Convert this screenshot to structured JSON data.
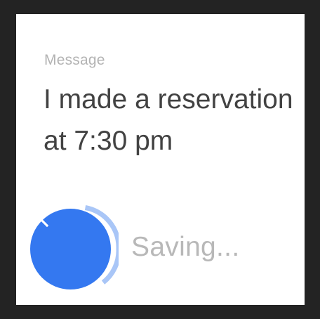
{
  "card": {
    "label": "Message",
    "message": "I made a reservation at 7:30 pm"
  },
  "action": {
    "icon": "close-icon",
    "status": "Saving...",
    "progress": 0.3,
    "colors": {
      "button": "#3478f0",
      "ring": "#a9c6f7"
    }
  }
}
